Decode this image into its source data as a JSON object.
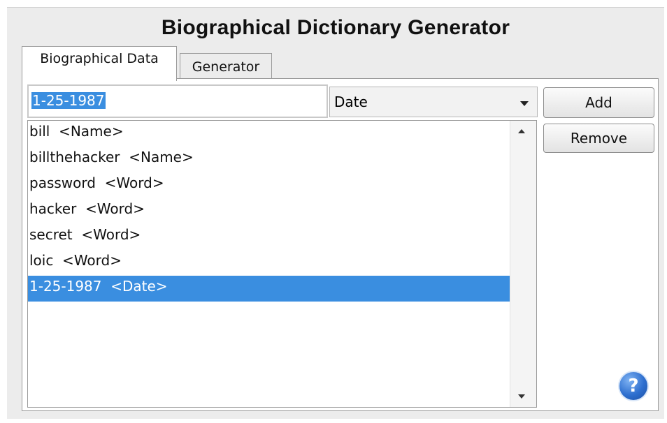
{
  "window": {
    "title": "Biographical Dictionary Generator"
  },
  "tabs": [
    {
      "label": "Biographical Data",
      "active": true
    },
    {
      "label": "Generator",
      "active": false
    }
  ],
  "input": {
    "value": "1-25-1987"
  },
  "type_select": {
    "selected": "Date"
  },
  "buttons": {
    "add": "Add",
    "remove": "Remove"
  },
  "list": {
    "items": [
      {
        "text": "bill  <Name>"
      },
      {
        "text": "billthehacker  <Name>"
      },
      {
        "text": "password  <Word>"
      },
      {
        "text": "hacker  <Word>"
      },
      {
        "text": "secret  <Word>"
      },
      {
        "text": "loic  <Word>"
      },
      {
        "text": "1-25-1987  <Date>",
        "selected": true
      }
    ]
  },
  "help": {
    "icon": "question-circle-icon",
    "glyph": "?"
  },
  "colors": {
    "selection": "#3a8ee0",
    "background": "#ececec",
    "help_icon": "#2e6fcf"
  }
}
